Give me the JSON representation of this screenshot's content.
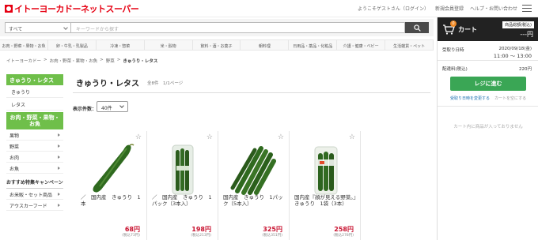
{
  "header": {
    "logo_text": "イトーヨーカドーネットスーパー",
    "links": [
      "ようこそゲストさん（ログイン）",
      "新規会員登録",
      "ヘルプ・お問い合わせ"
    ]
  },
  "search": {
    "category": "すべて",
    "placeholder": "キーワードから探す"
  },
  "category_nav": [
    "お肉・野菜・果物・お魚",
    "卵・牛乳・乳製品",
    "冷凍・惣菜",
    "米・穀物",
    "飲料・酒・お菓子",
    "朝料理",
    "日用品・薬品・化粧品",
    "介護・健康・ベビー",
    "生活雑貨・ペット"
  ],
  "breadcrumb": [
    "イトーヨーカドー",
    ">",
    "お肉・野菜・果物・お魚",
    ">",
    "野菜",
    ">",
    "きゅうり・レタス"
  ],
  "sidebar": {
    "head": "きゅうり・レタス",
    "subs": [
      "きゅうり",
      "レタス"
    ],
    "head2": "お肉・野菜・果物・お魚",
    "cats": [
      "果物",
      "野菜",
      "お肉",
      "お魚"
    ],
    "featured": "おすすめ特集キャンペーン",
    "features": [
      "お米販・セット商品",
      "アウスカーフード"
    ]
  },
  "main": {
    "title": "きゅうり・レタス",
    "hits": "全8件　1/1ページ",
    "perpage_label": "表示件数：",
    "perpage_value": "40件"
  },
  "products": [
    {
      "name": "／　国内産　きゅうり　1本",
      "price": "68円",
      "tax": "(税込73円)"
    },
    {
      "name": "／　国内産　きゅうり　1パック（3本入）",
      "price": "198円",
      "tax": "(税込213円)"
    },
    {
      "name": "国内産　きゅうり　1パック（5本入）",
      "price": "325円",
      "tax": "(税込351円)"
    },
    {
      "name": "国内産『顔が見える野菜。』　きゅうり　1袋（3本）",
      "price": "258円",
      "tax": "(税込278円)"
    }
  ],
  "cart": {
    "badge": "0",
    "title": "カート",
    "sum_label": "商品総額(税込)",
    "sum": "---円",
    "delivery_label": "受取り日時",
    "delivery_date": "2020/09/18(金)",
    "delivery_time": "11:00 ～ 13:00",
    "fee_label": "配達料(税込)",
    "fee": "220円",
    "checkout": "レジに進む",
    "link_change": "受取り日時を変更する",
    "link_clear": "カートを空にする",
    "empty": "カート内に商品が入っておりません"
  },
  "colors": {
    "brand_red": "#e60012",
    "sidebar_green": "#6fbf4a",
    "checkout_green": "#3aa655",
    "price_red": "#c8102e"
  }
}
